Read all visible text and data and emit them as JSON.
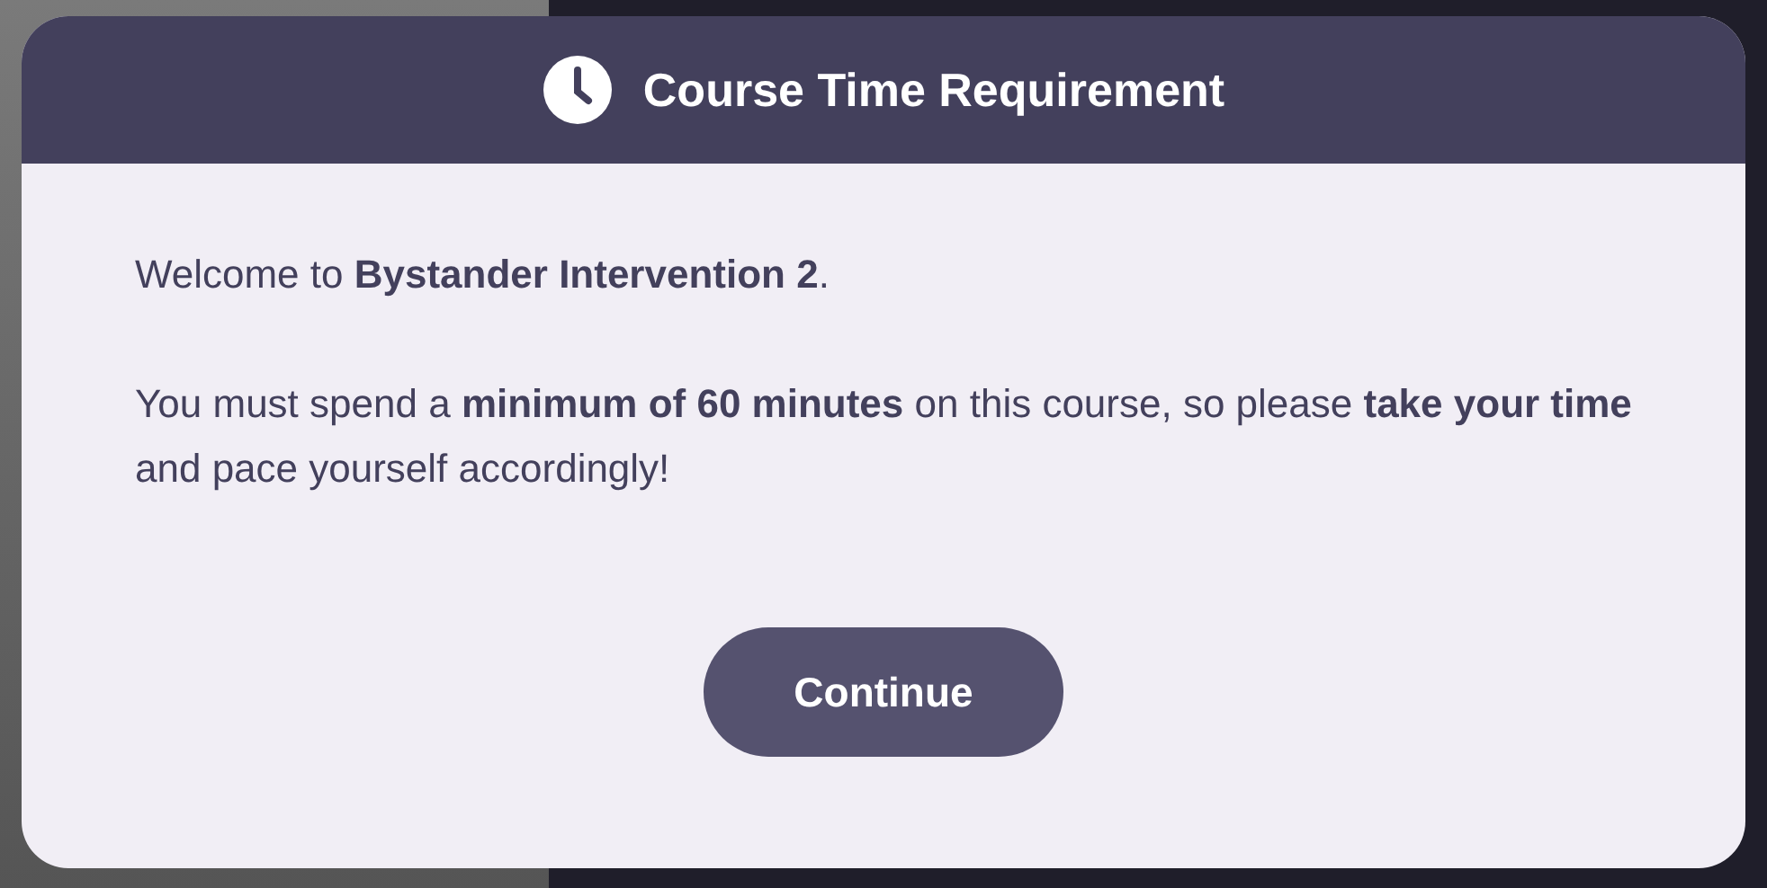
{
  "dialog": {
    "title": "Course Time Requirement",
    "paragraphs": [
      "Welcome to **Bystander Intervention 2**.",
      "You must spend a **minimum of 60 minutes** on this course, so please **take your time** and pace yourself accordingly!"
    ],
    "button": "Continue"
  }
}
